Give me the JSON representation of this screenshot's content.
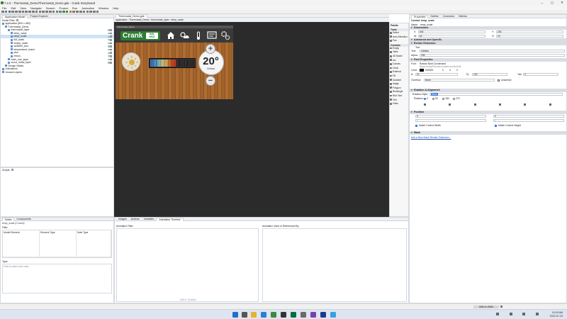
{
  "window": {
    "title": "7.2.0 - Thermostat_Demo/Thermostat_Demo.gde - Crank Storyboard"
  },
  "menu": [
    "File",
    "Edit",
    "View",
    "Navigate",
    "Search",
    "Project",
    "Run",
    "Animation",
    "Window",
    "Help"
  ],
  "left_tabs": {
    "app_model": "Application Model",
    "project_explorer": "Project Explorer"
  },
  "model_filter_label": "Model Filter:",
  "tree": [
    {
      "label": "application [800 x 480]",
      "indent": 0
    },
    {
      "label": "Thermostat_Demo",
      "indent": 1
    },
    {
      "label": "thermostat_layer",
      "indent": 2
    },
    {
      "label": "temp_value",
      "indent": 3
    },
    {
      "label": "temp_scale",
      "indent": 3,
      "selected": true
    },
    {
      "label": "full_scale",
      "indent": 3
    },
    {
      "label": "empty_scale",
      "indent": 3
    },
    {
      "label": "weather_icon",
      "indent": 3
    },
    {
      "label": "temperature_frame",
      "indent": 3
    },
    {
      "label": "plus",
      "indent": 3
    },
    {
      "label": "minus",
      "indent": 3
    },
    {
      "label": "main_nav_layer",
      "indent": 2
    },
    {
      "label": "wood_metal_layer",
      "indent": 2
    },
    {
      "label": "Design States",
      "indent": 1
    },
    {
      "label": "Animations",
      "indent": 0
    },
    {
      "label": "Unused Layers",
      "indent": 0
    }
  ],
  "scripts_label": "Scripts:",
  "notes_tabs": {
    "notes": "Notes",
    "components": "Components"
  },
  "notes": {
    "context": "temp_scale (Control)",
    "filter_label": "Filter:",
    "columns": [
      "Model Element",
      "Element Type",
      "Note Type"
    ],
    "type_label": "Type:",
    "add_note_placeholder": "Click to add a new note..."
  },
  "editor": {
    "tab": "Thermostat_Demo.gde",
    "breadcrumb": [
      "application",
      "Thermostat_Demo",
      "thermostat_layer",
      "temp_scale"
    ],
    "canvas_tab": "Thermostat_Demo"
  },
  "thermostat": {
    "brand": "Crank",
    "badge_line1": "HAIL",
    "badge_line2": "HEAT",
    "temperature": "20°",
    "temp_unit": "Celsius",
    "plus_icon": "plus-icon",
    "minus_icon": "minus-icon",
    "scale_level": 0.6
  },
  "palette": {
    "title": "Palette",
    "sections": [
      {
        "name": "Tools",
        "items": [
          "Select",
          "Area Selection",
          "Pan"
        ]
      },
      {
        "name": "Controls",
        "items": [
          "Empty",
          "Table",
          "3D Model",
          "Arc",
          "Canvas",
          "Circle",
          "External",
          "Fill",
          "Gradient",
          "Image",
          "Polygon",
          "Rectangle",
          "Rich Text",
          "Text",
          "Video"
        ]
      }
    ]
  },
  "bottom_tabs": [
    "Images",
    "Actions",
    "Variables",
    "Animation Timeline"
  ],
  "animation": {
    "filter_label": "Animation Filter:",
    "used_label": "Animation Used or Referenced By:",
    "edit_button": "Edit in Timeline"
  },
  "props_tabs": [
    "Properties",
    "Outline",
    "Connector",
    "Metrics"
  ],
  "props": {
    "control": "Control: temp_scale",
    "name_label": "Name:",
    "name_value": "temp_scale",
    "dimensions": {
      "title": "Dimensions",
      "x_label": "X:",
      "x": "504",
      "y_label": "Y:",
      "y": "293",
      "w_label": "W:",
      "w": "62",
      "h_label": "H:",
      "h": "24"
    },
    "advanced": "Advanced and OpenGL",
    "render_ext": {
      "title": "Render Extension",
      "type": "Text",
      "text_label": "Text:",
      "text": "Celsius",
      "alpha_label": "Alpha:",
      "alpha": "255"
    },
    "font": {
      "title": "Font Properties",
      "font_label": "Font:",
      "font_value": "Roboto Bold Condensed",
      "font_path": "${sys:fonts}/RobotoCondensed-Bold.ttf",
      "color_label": "Color:",
      "color": "000000",
      "r": "0",
      "g": "0",
      "b": "0",
      "size_label": "Ä:",
      "size": "21",
      "line_label": "ÌÇ:",
      "line": "100",
      "tab_label": "Tab:",
      "tab": "0",
      "overflow_label": "Overflow:",
      "overflow": "None",
      "underline_label": "Underline"
    },
    "rotation": {
      "title": "Rotation & Alignment",
      "style_label": "Rotation Style:",
      "style_value": "None",
      "rotation_label": "Rotation:",
      "options": [
        "0",
        "90",
        "180",
        "270"
      ]
    },
    "position": {
      "title": "Position",
      "x": "0",
      "y": "0",
      "w": "0",
      "h": "0",
      "match_width": "Match Control Width",
      "match_height": "Match Control Height"
    },
    "mask": "Mask",
    "add_render_ext": "Add a New Mask Render Extension..."
  },
  "statusbar": {
    "memory": "50M of 196M"
  },
  "tray": {
    "time": "10:29 AM",
    "date": "2022-07-23"
  },
  "colors": {
    "accent": "#2e7d32",
    "wood": "#a0622b",
    "canvas_bg": "#2b2b2b"
  }
}
